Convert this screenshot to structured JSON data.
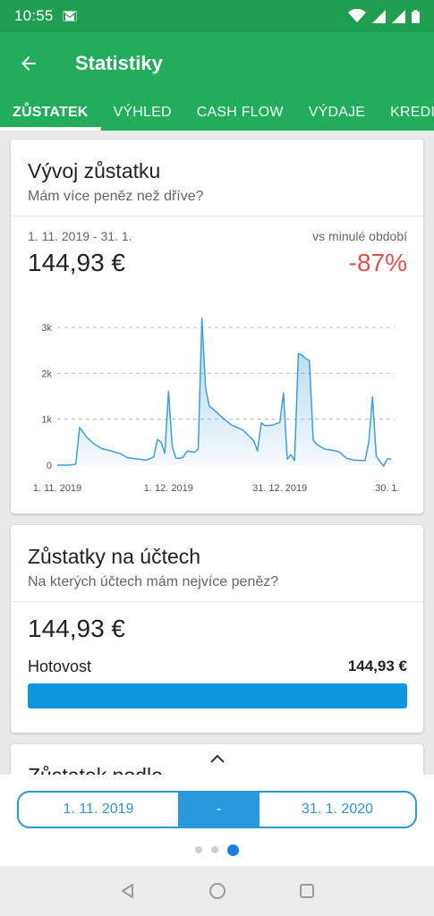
{
  "status_bar": {
    "time": "10:55"
  },
  "app_bar": {
    "title": "Statistiky"
  },
  "tabs": [
    {
      "label": "ZŮSTATEK",
      "active": true
    },
    {
      "label": "VÝHLED",
      "active": false
    },
    {
      "label": "CASH FLOW",
      "active": false
    },
    {
      "label": "VÝDAJE",
      "active": false
    },
    {
      "label": "KREDIT",
      "active": false
    }
  ],
  "balance_card": {
    "title": "Vývoj zůstatku",
    "subtitle": "Mám více peněz než dříve?",
    "period": "1. 11. 2019 - 31. 1.",
    "vs_label": "vs minulé období",
    "amount": "144,93 €",
    "change": "-87%",
    "change_color": "#e0524e"
  },
  "chart_data": {
    "type": "area",
    "x_tick_labels": [
      "1. 11. 2019",
      "1. 12. 2019",
      "31. 12. 2019",
      "30. 1."
    ],
    "y_tick_labels": [
      "0",
      "1k",
      "2k",
      "3k"
    ],
    "ylim": [
      0,
      3000
    ],
    "grid": true,
    "color": "#3f9edb",
    "x_day_range": [
      0,
      90
    ],
    "points": [
      [
        0,
        0
      ],
      [
        3,
        0
      ],
      [
        5,
        20
      ],
      [
        6,
        820
      ],
      [
        8,
        600
      ],
      [
        10,
        460
      ],
      [
        12,
        360
      ],
      [
        15,
        300
      ],
      [
        17,
        250
      ],
      [
        19,
        160
      ],
      [
        22,
        130
      ],
      [
        24,
        110
      ],
      [
        26,
        180
      ],
      [
        27,
        560
      ],
      [
        28,
        500
      ],
      [
        29,
        260
      ],
      [
        30,
        1610
      ],
      [
        31,
        400
      ],
      [
        32,
        150
      ],
      [
        33,
        150
      ],
      [
        34,
        180
      ],
      [
        35,
        310
      ],
      [
        37,
        280
      ],
      [
        38,
        350
      ],
      [
        39,
        3200
      ],
      [
        40,
        1670
      ],
      [
        41,
        1290
      ],
      [
        43,
        1150
      ],
      [
        45,
        1000
      ],
      [
        47,
        870
      ],
      [
        50,
        770
      ],
      [
        53,
        530
      ],
      [
        54,
        310
      ],
      [
        55,
        920
      ],
      [
        56,
        860
      ],
      [
        58,
        870
      ],
      [
        60,
        930
      ],
      [
        61,
        1570
      ],
      [
        62,
        130
      ],
      [
        63,
        230
      ],
      [
        64,
        100
      ],
      [
        65,
        2430
      ],
      [
        66,
        2400
      ],
      [
        67,
        2320
      ],
      [
        68,
        2280
      ],
      [
        69,
        550
      ],
      [
        70,
        450
      ],
      [
        72,
        350
      ],
      [
        74,
        330
      ],
      [
        76,
        290
      ],
      [
        78,
        150
      ],
      [
        80,
        110
      ],
      [
        83,
        100
      ],
      [
        84,
        500
      ],
      [
        85,
        1490
      ],
      [
        86,
        200
      ],
      [
        87,
        80
      ],
      [
        88,
        -20
      ],
      [
        89,
        140
      ],
      [
        90,
        130
      ]
    ]
  },
  "accounts_card": {
    "title": "Zůstatky na účtech",
    "subtitle": "Na kterých účtech mám nejvíce peněz?",
    "amount": "144,93 €",
    "accounts": [
      {
        "name": "Hotovost",
        "value": "144,93 €",
        "share": 1.0
      }
    ],
    "bar_color": "#0d96de"
  },
  "third_card": {
    "title": "Zůstatek podle"
  },
  "date_range": {
    "from": "1. 11. 2019",
    "separator": "-",
    "to": "31. 1. 2020"
  },
  "pager": {
    "count": 3,
    "active_index": 2
  }
}
